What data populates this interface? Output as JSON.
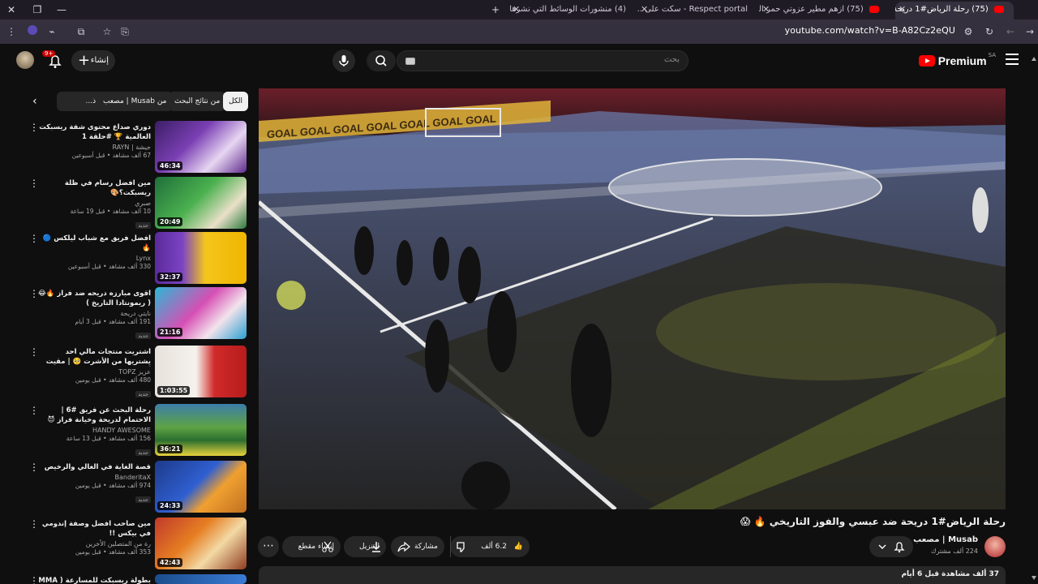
{
  "browser": {
    "tabs": [
      {
        "title": "(75) رحلة الرياض#1 دريحة ...",
        "active": true
      },
      {
        "title": "(75) ازهم مطير عزوتي حمر النواظ..."
      },
      {
        "title": "Respect portal - سكت على ..."
      },
      {
        "title": "(4) منشورات الوسائط التي نشرها"
      }
    ],
    "url": "youtube.com/watch?v=B-A82Cz2eQU"
  },
  "header": {
    "logo_text": "Premium",
    "region": "SA",
    "search_placeholder": "بحث",
    "create_label": "إنشاء",
    "notif_count": "9+"
  },
  "chips": [
    {
      "label": "الكل",
      "selected": true
    },
    {
      "label": "من نتائج البحث"
    },
    {
      "label": "من Musab | مصعب"
    },
    {
      "label": "محتوى ذ..."
    }
  ],
  "recommendations": [
    {
      "title": "دوري صداع محتوى شفة ريسبكت العالمية 🏆 #حلقة 1",
      "channel": "جيشة | RAYN",
      "meta": "67 ألف مشاهد • قبل أسبوعين",
      "duration": "46:34",
      "new": false,
      "thumb": "purple"
    },
    {
      "title": "مين افضل رسام في ظلة ريسبكت؟🎨",
      "channel": "صبري",
      "meta": "10 آلف مشاهد • قبل 19 ساعة",
      "duration": "20:49",
      "new": true,
      "new_label": "جديد",
      "thumb": "green"
    },
    {
      "title": "افضل فريق مع شباب ليلكس 🔵🔥",
      "channel": "Lynx",
      "meta": "330 ألف مشاهد • قبل أسبوعين",
      "duration": "32:37",
      "new": false,
      "thumb": "yellow"
    },
    {
      "title": "اقوى مبارزه دريحه ضد فراز 🔥😂 ( ريمونتادا التاريخ )",
      "channel": "نايتي دريحة",
      "meta": "191 ألف مشاهد • قبل 3 أيام",
      "duration": "21:16",
      "new": true,
      "new_label": "جديد",
      "thumb": "pink"
    },
    {
      "title": "اشتريت منتجات مالي احد يشتريها من الأشرت 🥺 | مقيت أعضاء TU 😭🔥",
      "channel": "عزيز TOPZ",
      "meta": "480 ألف مشاهد • قبل يومين",
      "duration": "1:03:55",
      "new": true,
      "new_label": "جديد",
      "thumb": "red"
    },
    {
      "title": "رحلة البحث عن فريق #6 | الاحتمام لدريحة وخيانة فراز 😈",
      "channel": "HANDY AWESOME",
      "meta": "156 ألف مشاهد • قبل 13 ساعة",
      "duration": "36:21",
      "new": true,
      "new_label": "جديد",
      "thumb": "stadium"
    },
    {
      "title": "قصة الغاية في الغالي والرخيص",
      "channel": "BanderitaX",
      "meta": "974 ألف مشاهد • قبل يومين",
      "duration": "24:33",
      "new": true,
      "new_label": "جديد",
      "thumb": "orange"
    },
    {
      "title": "مين صاحب افضل وصفة إندومي في بيكس !!",
      "channel": "سعيد | saeed",
      "meta": "353 ألف مشاهد • قبل يومين",
      "duration": "42:43",
      "new": false,
      "sub": "رة من المتصلين الأخرين",
      "thumb": "food"
    },
    {
      "title": "بطولة ريسبكت للمسارعة ( MMA ) مع",
      "channel": "",
      "meta": "",
      "duration": "",
      "new": false,
      "thumb": "blue"
    }
  ],
  "video": {
    "title": "رحلة الرياض#1 دريحة ضد عبسي والفوز التاريخي 🔥 😱",
    "channel": "Musab | مصعب",
    "subs": "224 ألف مشترك",
    "likes": "6.2 ألف",
    "share_label": "مشاركة",
    "download_label": "التنزيل",
    "clip_label": "إنشاء مقطع",
    "views_line": "37 ألف مشاهدة قبل 6 أيام",
    "scene_text": "GOAL"
  }
}
